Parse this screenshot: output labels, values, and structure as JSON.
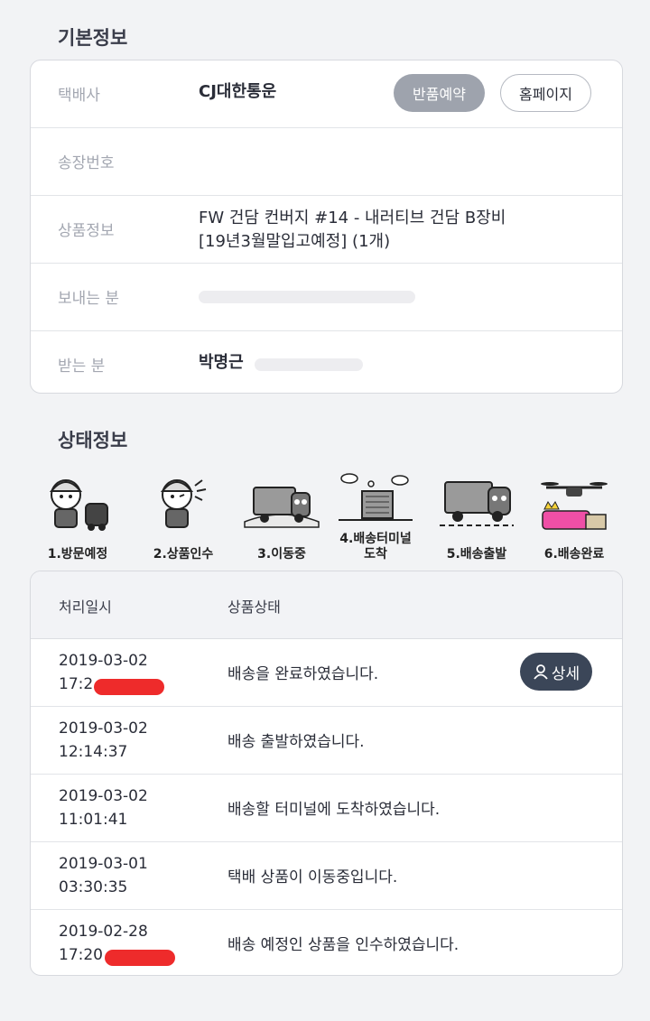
{
  "basic": {
    "title": "기본정보",
    "courier_label": "택배사",
    "courier_value": "CJ대한통운",
    "return_button": "반품예약",
    "home_button": "홈페이지",
    "tracking_label": "송장번호",
    "tracking_value": "",
    "product_label": "상품정보",
    "product_line1": "FW 건담 컨버지 #14 - 내러티브 건담 B장비",
    "product_line2": "[19년3월말입고예정] (1개)",
    "sender_label": "보내는 분",
    "sender_value": "",
    "receiver_label": "받는 분",
    "receiver_value": "박명근"
  },
  "status": {
    "title": "상태정보",
    "steps": [
      {
        "label": "1.방문예정",
        "icon": "visit-scheduled-icon"
      },
      {
        "label": "2.상품인수",
        "icon": "product-pickup-icon"
      },
      {
        "label": "3.이동중",
        "icon": "in-transit-truck-icon"
      },
      {
        "label": "4.배송터미널\n도착",
        "icon": "terminal-building-icon"
      },
      {
        "label": "5.배송출발",
        "icon": "delivery-truck-icon"
      },
      {
        "label": "6.배송완료",
        "icon": "drone-delivered-icon"
      }
    ],
    "col_date": "처리일시",
    "col_status": "상품상태",
    "detail_button": "상세",
    "rows": [
      {
        "date": "2019-03-02",
        "time": "17:2",
        "desc": "배송을 완료하였습니다."
      },
      {
        "date": "2019-03-02",
        "time": "12:14:37",
        "desc": "배송 출발하였습니다."
      },
      {
        "date": "2019-03-02",
        "time": "11:01:41",
        "desc": "배송할 터미널에 도착하였습니다."
      },
      {
        "date": "2019-03-01",
        "time": "03:30:35",
        "desc": "택배 상품이 이동중입니다."
      },
      {
        "date": "2019-02-28",
        "time": "17:20",
        "desc": "배송 예정인 상품을 인수하였습니다."
      }
    ]
  },
  "colors": {
    "accent_dark": "#3b4658",
    "button_gray": "#9ea3ad",
    "redaction": "#ee2b2b"
  }
}
